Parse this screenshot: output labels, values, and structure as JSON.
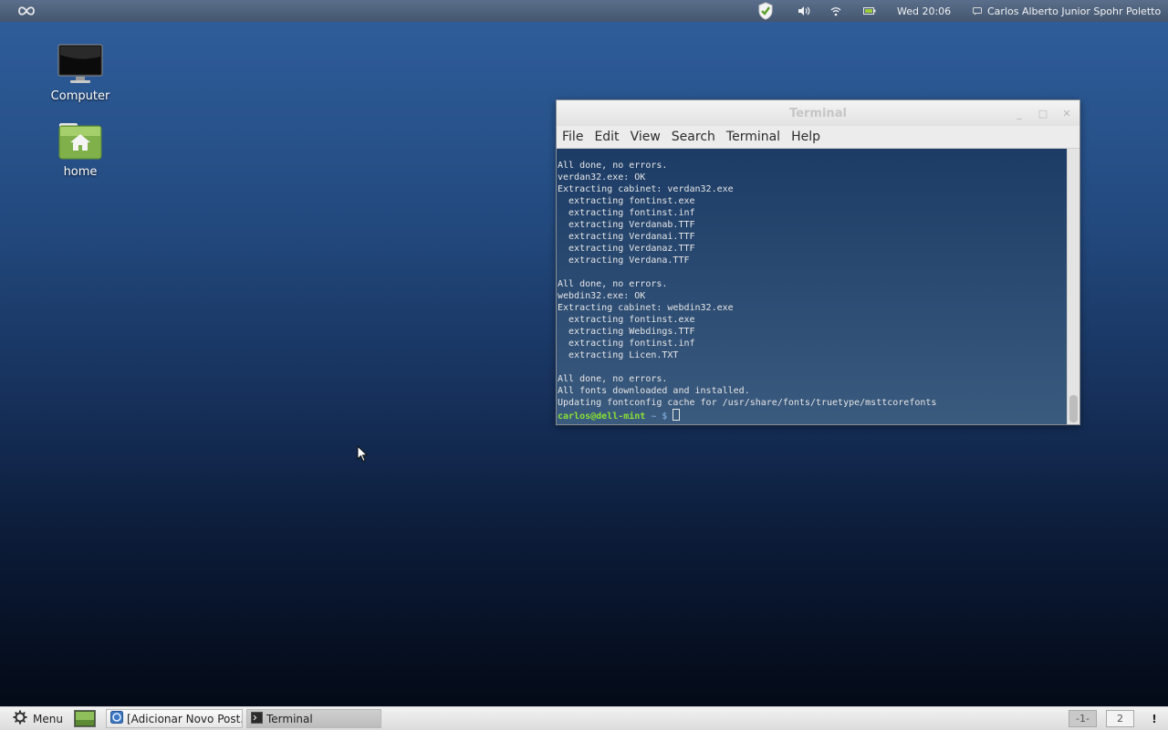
{
  "top_panel": {
    "logo_icon": "mint-infinity-logo-icon",
    "tray_icons": [
      "shield-update-icon",
      "volume-icon",
      "wifi-icon",
      "battery-icon"
    ],
    "clock": "Wed 20:06",
    "user_name": "Carlos Alberto Junior Spohr Poletto"
  },
  "desktop": {
    "icons": [
      {
        "label": "Computer",
        "icon": "monitor-icon"
      },
      {
        "label": "home",
        "icon": "home-folder-icon"
      }
    ]
  },
  "terminal": {
    "title": "Terminal",
    "menu": [
      "File",
      "Edit",
      "View",
      "Search",
      "Terminal",
      "Help"
    ],
    "output": "All done, no errors.\nverdan32.exe: OK\nExtracting cabinet: verdan32.exe\n  extracting fontinst.exe\n  extracting fontinst.inf\n  extracting Verdanab.TTF\n  extracting Verdanai.TTF\n  extracting Verdanaz.TTF\n  extracting Verdana.TTF\n\nAll done, no errors.\nwebdin32.exe: OK\nExtracting cabinet: webdin32.exe\n  extracting fontinst.exe\n  extracting Webdings.TTF\n  extracting fontinst.inf\n  extracting Licen.TXT\n\nAll done, no errors.\nAll fonts downloaded and installed.\nUpdating fontconfig cache for /usr/share/fonts/truetype/msttcorefonts",
    "prompt_user": "carlos@dell-mint",
    "prompt_path": " ~ $ "
  },
  "bottom_panel": {
    "menu_label": "Menu",
    "tasks": [
      "[Adicionar Novo Post...",
      "Terminal"
    ],
    "workspaces": [
      "-1-",
      "2"
    ],
    "alert": "!"
  },
  "colors": {
    "prompt_user": "#8ae234",
    "prompt_path": "#729fcf",
    "desktop_top": "#2f5f9d",
    "desktop_bottom": "#030812"
  }
}
